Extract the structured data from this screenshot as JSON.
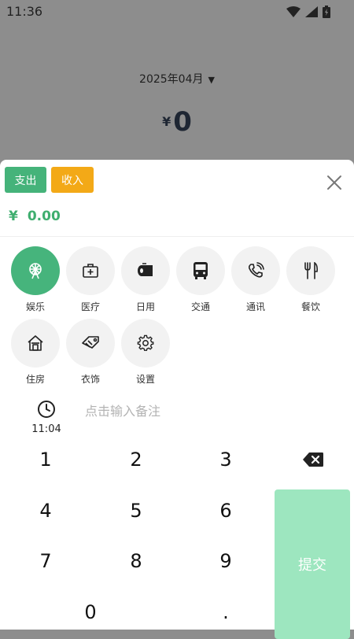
{
  "status": {
    "time": "11:36"
  },
  "background": {
    "month": "2025年04月",
    "currency": "¥",
    "total": "0"
  },
  "sheet": {
    "expense_label": "支出",
    "income_label": "收入",
    "amount_currency": "¥",
    "amount_value": "0.00",
    "categories": [
      {
        "label": "娱乐",
        "icon": "ferris-wheel-icon",
        "selected": true
      },
      {
        "label": "医疗",
        "icon": "medical-kit-icon"
      },
      {
        "label": "日用",
        "icon": "tissue-roll-icon"
      },
      {
        "label": "交通",
        "icon": "bus-icon"
      },
      {
        "label": "通讯",
        "icon": "phone-icon"
      },
      {
        "label": "餐饮",
        "icon": "fork-knife-icon"
      },
      {
        "label": "住房",
        "icon": "house-icon"
      },
      {
        "label": "衣饰",
        "icon": "clothing-tag-icon"
      },
      {
        "label": "设置",
        "icon": "gear-icon"
      }
    ],
    "time": "11:04",
    "note_placeholder": "点击输入备注"
  },
  "keypad": {
    "keys": [
      "1",
      "2",
      "3",
      "4",
      "5",
      "6",
      "7",
      "8",
      "9",
      "0",
      "."
    ],
    "submit_label": "提交"
  },
  "colors": {
    "accent": "#46b47c",
    "income": "#f3a917",
    "submit": "#9de6bf"
  }
}
